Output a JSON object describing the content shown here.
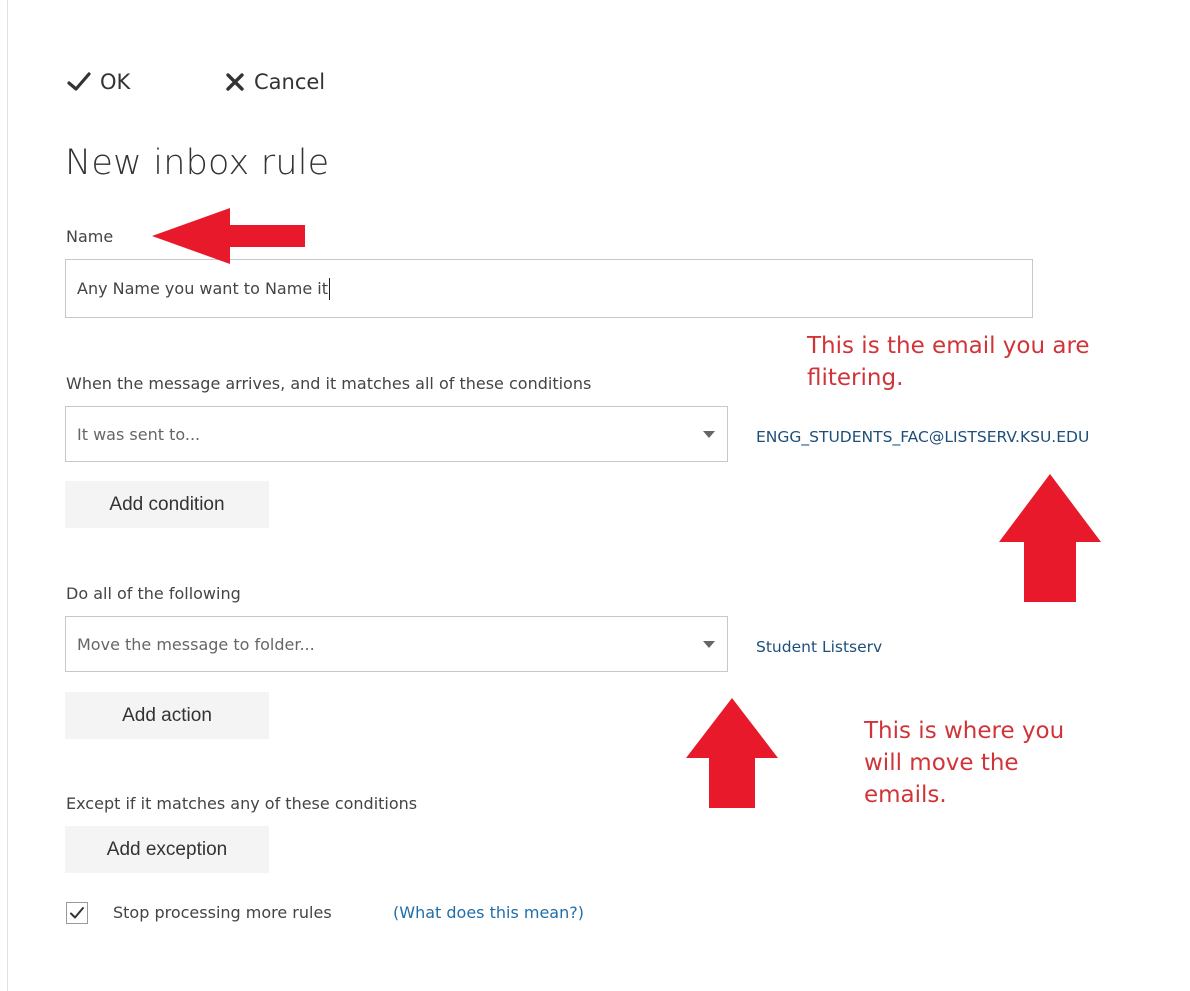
{
  "commands": {
    "ok_label": "OK",
    "cancel_label": "Cancel"
  },
  "page_title": "New inbox rule",
  "name_section": {
    "label": "Name",
    "value": "Any Name you want to Name it"
  },
  "conditions_section": {
    "label": "When the message arrives, and it matches all of these conditions",
    "selected": "It was sent to...",
    "value": "ENGG_STUDENTS_FAC@LISTSERV.KSU.EDU",
    "add_button": "Add condition"
  },
  "actions_section": {
    "label": "Do all of the following",
    "selected": "Move the message to folder...",
    "value": "Student Listserv",
    "add_button": "Add action"
  },
  "exceptions_section": {
    "label": "Except if it matches any of these conditions",
    "add_button": "Add exception"
  },
  "stop_processing": {
    "checked": true,
    "label": "Stop processing more rules",
    "help_link": "(What does this mean?)"
  },
  "annotations": {
    "email_note": [
      "This is the email you are",
      "flitering."
    ],
    "move_note": [
      "This is where you",
      "will move the",
      "emails."
    ]
  },
  "colors": {
    "annotation_red": "#d13438",
    "arrow_red": "#e8192a",
    "link_blue": "#1f6ea8",
    "value_blue": "#1e4f7a",
    "button_gray": "#f4f4f4"
  },
  "icons": [
    "checkmark-icon",
    "close-icon",
    "dropdown-arrow-icon",
    "arrow-left-icon",
    "arrow-up-icon"
  ]
}
